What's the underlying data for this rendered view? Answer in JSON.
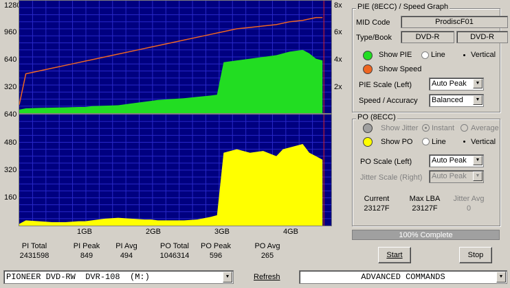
{
  "pie_chart": {
    "y_ticks_left": [
      "1280",
      "960",
      "640",
      "320"
    ],
    "y_ticks_right": [
      "8x",
      "6x",
      "4x",
      "2x"
    ],
    "bottom_label": "640"
  },
  "po_chart": {
    "y_ticks_left": [
      "480",
      "320",
      "160"
    ],
    "x_ticks": [
      "1GB",
      "2GB",
      "3GB",
      "4GB"
    ]
  },
  "chart_data": [
    {
      "type": "area",
      "title": "",
      "x": [
        0.0,
        0.1,
        0.3,
        0.5,
        0.7,
        0.9,
        1.0,
        1.1,
        1.3,
        1.5,
        1.7,
        1.9,
        2.0,
        2.1,
        2.3,
        2.5,
        2.7,
        2.9,
        3.0,
        3.1,
        3.3,
        3.5,
        3.7,
        3.9,
        4.0,
        4.1,
        4.3,
        4.4,
        4.5,
        4.6
      ],
      "series": [
        {
          "name": "",
          "values": [
            40,
            55,
            60,
            62,
            65,
            70,
            70,
            80,
            85,
            90,
            110,
            130,
            140,
            150,
            160,
            170,
            185,
            200,
            210,
            580,
            600,
            620,
            640,
            660,
            680,
            700,
            720,
            680,
            620,
            600
          ]
        },
        {
          "name": "",
          "values": [
            0.6,
            2.8,
            3.0,
            3.2,
            3.4,
            3.6,
            3.7,
            3.8,
            4.0,
            4.2,
            4.4,
            4.6,
            4.7,
            4.8,
            5.0,
            5.2,
            5.4,
            5.6,
            5.7,
            5.8,
            6.0,
            6.1,
            6.2,
            6.3,
            6.4,
            6.5,
            6.6,
            6.7,
            6.8,
            6.8
          ]
        }
      ],
      "ylim": [
        0,
        1280
      ],
      "y2lim": [
        0,
        8
      ]
    },
    {
      "type": "area",
      "title": "",
      "x": [
        0.0,
        0.1,
        0.3,
        0.5,
        0.7,
        0.9,
        1.0,
        1.1,
        1.3,
        1.5,
        1.7,
        1.9,
        2.0,
        2.1,
        2.3,
        2.5,
        2.7,
        2.9,
        3.0,
        3.1,
        3.3,
        3.5,
        3.7,
        3.9,
        4.0,
        4.1,
        4.3,
        4.4,
        4.5,
        4.6
      ],
      "series": [
        {
          "name": "",
          "values": [
            10,
            30,
            25,
            20,
            20,
            25,
            25,
            30,
            40,
            45,
            40,
            35,
            35,
            30,
            30,
            30,
            35,
            50,
            60,
            420,
            440,
            420,
            430,
            400,
            440,
            450,
            470,
            420,
            400,
            380
          ]
        }
      ],
      "ylim": [
        0,
        640
      ],
      "x_unit": "GB"
    }
  ],
  "stats": [
    {
      "label": "PI Total",
      "value": "2431598"
    },
    {
      "label": "PI Peak",
      "value": "849"
    },
    {
      "label": "PI Avg",
      "value": "494"
    },
    {
      "label": "PO Total",
      "value": "1046314"
    },
    {
      "label": "PO Peak",
      "value": "596"
    },
    {
      "label": "PO Avg",
      "value": "265"
    }
  ],
  "pie_group": {
    "title": "PIE (8ECC) / Speed Graph",
    "mid_label": "MID Code",
    "mid_value": "ProdiscF01",
    "typebook_label": "Type/Book",
    "type_value": "DVD-R",
    "book_value": "DVD-R",
    "show_pie": "Show PIE",
    "line": "Line",
    "vertical": "Vertical",
    "show_speed": "Show Speed",
    "pie_scale_label": "PIE Scale (Left)",
    "pie_scale_value": "Auto Peak",
    "speed_acc_label": "Speed / Accuracy",
    "speed_acc_value": "Balanced",
    "pie_color": "#22dd22",
    "speed_color": "#ee6622"
  },
  "po_group": {
    "title": "PO (8ECC)",
    "show_jitter": "Show Jitter",
    "instant": "Instant",
    "average": "Average",
    "show_po": "Show PO",
    "line": "Line",
    "vertical": "Vertical",
    "po_scale_label": "PO Scale (Left)",
    "po_scale_value": "Auto Peak",
    "jitter_scale_label": "Jitter Scale (Right)",
    "jitter_scale_value": "Auto Peak",
    "current_label": "Current",
    "current_value": "23127F",
    "maxlba_label": "Max LBA",
    "maxlba_value": "23127F",
    "jitter_avg_label": "Jitter Avg",
    "jitter_avg_value": "0",
    "po_color": "#ffff00"
  },
  "progress": {
    "text": "100% Complete",
    "fraction": 1.0
  },
  "buttons": {
    "start": "Start",
    "stop": "Stop"
  },
  "bottom": {
    "drive": "PIONEER DVD-RW  DVR-108  (M:)",
    "refresh": "Refresh",
    "advanced": "ADVANCED COMMANDS"
  }
}
